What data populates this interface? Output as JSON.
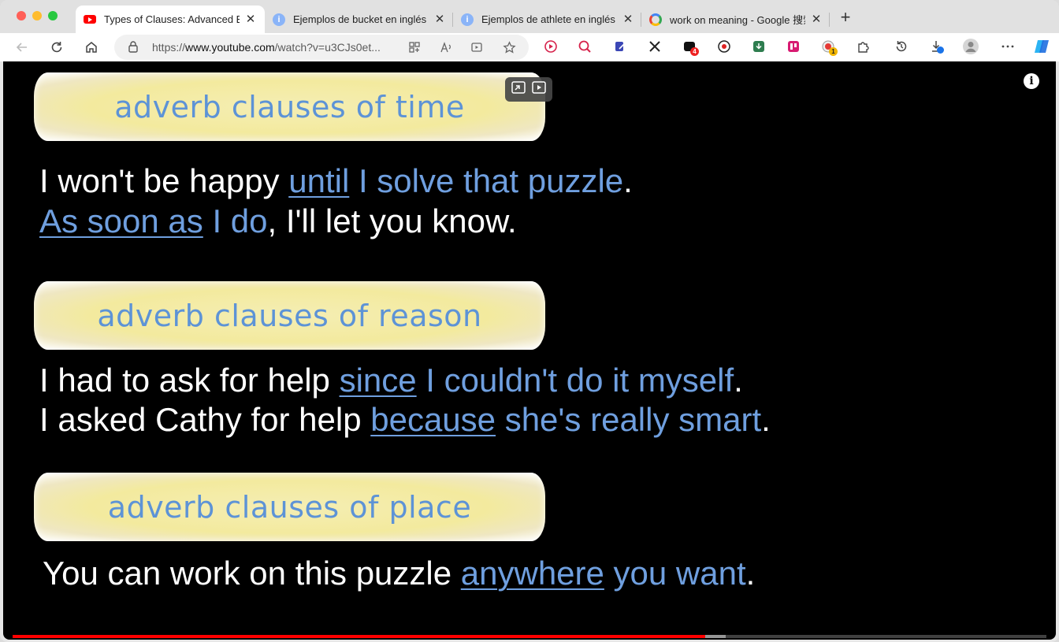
{
  "browser": {
    "tabs": [
      {
        "title": "Types of Clauses: Advanced En",
        "favicon": "youtube-icon",
        "active": true
      },
      {
        "title": "Ejemplos de bucket en inglés |",
        "favicon": "info-icon",
        "active": false
      },
      {
        "title": "Ejemplos de athlete en inglés |",
        "favicon": "info-icon",
        "active": false
      },
      {
        "title": "work on meaning - Google 搜索",
        "favicon": "google-icon",
        "active": false
      }
    ],
    "close_glyph": "✕",
    "new_tab_glyph": "+",
    "address": {
      "scheme": "https://",
      "host": "www.youtube.com",
      "path": "/watch?v=u3CJs0et..."
    },
    "extension_badges": {
      "ext4": "4",
      "ext10": "1"
    }
  },
  "video": {
    "sections": [
      {
        "banner": "adverb clauses of time",
        "sentences": [
          [
            {
              "t": "I won't be happy ",
              "s": "w"
            },
            {
              "t": "until",
              "s": "u"
            },
            {
              "t": " I solve that puzzle",
              "s": "b"
            },
            {
              "t": ".",
              "s": "w"
            }
          ],
          [
            {
              "t": "As soon as",
              "s": "u"
            },
            {
              "t": " I do",
              "s": "b"
            },
            {
              "t": ", I'll let you know.",
              "s": "w"
            }
          ]
        ]
      },
      {
        "banner": "adverb clauses of reason",
        "sentences": [
          [
            {
              "t": "I had to ask for help ",
              "s": "w"
            },
            {
              "t": "since",
              "s": "u"
            },
            {
              "t": " I couldn't do it myself",
              "s": "b"
            },
            {
              "t": ".",
              "s": "w"
            }
          ],
          [
            {
              "t": "I asked Cathy for help ",
              "s": "w"
            },
            {
              "t": "because",
              "s": "u"
            },
            {
              "t": " she's really smart",
              "s": "b"
            },
            {
              "t": ".",
              "s": "w"
            }
          ]
        ]
      },
      {
        "banner": "adverb clauses of place",
        "sentences": [
          [
            {
              "t": "You can work on this puzzle ",
              "s": "w"
            },
            {
              "t": "anywhere",
              "s": "u"
            },
            {
              "t": " you want",
              "s": "b"
            },
            {
              "t": ".",
              "s": "w"
            }
          ]
        ]
      }
    ],
    "info_glyph": "i",
    "progress": {
      "played_fraction": 0.67,
      "buffered_fraction": 0.69
    },
    "colors": {
      "highlight": "#6f9fdf",
      "banner_text": "#5d93d6",
      "progress": "#ff0000"
    }
  }
}
